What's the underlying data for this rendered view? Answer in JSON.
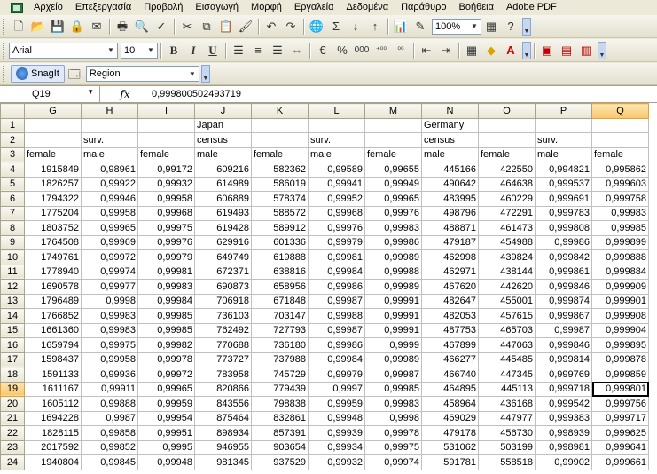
{
  "menubar": {
    "items": [
      "Αρχείο",
      "Επεξεργασία",
      "Προβολή",
      "Εισαγωγή",
      "Μορφή",
      "Εργαλεία",
      "Δεδομένα",
      "Παράθυρο",
      "Βοήθεια",
      "Adobe PDF"
    ]
  },
  "toolbar_standard": {
    "zoom": "100%",
    "icons": [
      "new-icon",
      "open-icon",
      "save-icon",
      "permission-icon",
      "email-icon",
      "print-icon",
      "print-preview-icon",
      "spelling-icon",
      "cut-icon",
      "copy-icon",
      "paste-icon",
      "format-painter-icon",
      "undo-icon",
      "redo-icon",
      "hyperlink-icon",
      "autosum-icon",
      "sort-ascending-icon",
      "sort-descending-icon",
      "chart-wizard-icon",
      "drawing-icon",
      "calculator-icon",
      "help-icon"
    ]
  },
  "toolbar_formatting": {
    "font": "Arial",
    "size": "10",
    "bold": "B",
    "italic": "I",
    "underline": "U",
    "currency": "€",
    "percent": "%",
    "thousands": "000",
    "inc_decimal": "⁺⁰⁰",
    "dec_decimal": "⁰⁰"
  },
  "toolbar_snagit": {
    "snagit_label": "SnagIt",
    "capture_mode": "Region"
  },
  "formulabar": {
    "cell_ref": "Q19",
    "fx": "fx",
    "content": "0,999800502493719"
  },
  "sheet": {
    "columns": [
      "G",
      "H",
      "I",
      "J",
      "K",
      "L",
      "M",
      "N",
      "O",
      "P",
      "Q"
    ],
    "selected_column": "Q",
    "selected_row": "19",
    "rows": [
      {
        "n": "1",
        "cells": [
          "",
          "",
          "",
          "Japan",
          "",
          "",
          "",
          "Germany",
          "",
          "",
          ""
        ]
      },
      {
        "n": "2",
        "cells": [
          "",
          "surv.",
          "",
          "census",
          "",
          "surv.",
          "",
          "census",
          "",
          "surv.",
          ""
        ]
      },
      {
        "n": "3",
        "cells": [
          "female",
          "male",
          "female",
          "male",
          "female",
          "male",
          "female",
          "male",
          "female",
          "male",
          "female"
        ]
      },
      {
        "n": "4",
        "cells": [
          "1915849",
          "0,98961",
          "0,99172",
          "609216",
          "582362",
          "0,99589",
          "0,99655",
          "445166",
          "422550",
          "0,994821",
          "0,995862"
        ]
      },
      {
        "n": "5",
        "cells": [
          "1826257",
          "0,99922",
          "0,99932",
          "614989",
          "586019",
          "0,99941",
          "0,99949",
          "490642",
          "464638",
          "0,999537",
          "0,999603"
        ]
      },
      {
        "n": "6",
        "cells": [
          "1794322",
          "0,99946",
          "0,99958",
          "606889",
          "578374",
          "0,99952",
          "0,99965",
          "483995",
          "460229",
          "0,999691",
          "0,999758"
        ]
      },
      {
        "n": "7",
        "cells": [
          "1775204",
          "0,99958",
          "0,99968",
          "619493",
          "588572",
          "0,99968",
          "0,99976",
          "498796",
          "472291",
          "0,999783",
          "0,99983"
        ]
      },
      {
        "n": "8",
        "cells": [
          "1803752",
          "0,99965",
          "0,99975",
          "619428",
          "589912",
          "0,99976",
          "0,99983",
          "488871",
          "461473",
          "0,999808",
          "0,99985"
        ]
      },
      {
        "n": "9",
        "cells": [
          "1764508",
          "0,99969",
          "0,99976",
          "629916",
          "601336",
          "0,99979",
          "0,99986",
          "479187",
          "454988",
          "0,99986",
          "0,999899"
        ]
      },
      {
        "n": "10",
        "cells": [
          "1749761",
          "0,99972",
          "0,99979",
          "649749",
          "619888",
          "0,99981",
          "0,99989",
          "462998",
          "439824",
          "0,999842",
          "0,999888"
        ]
      },
      {
        "n": "11",
        "cells": [
          "1778940",
          "0,99974",
          "0,99981",
          "672371",
          "638816",
          "0,99984",
          "0,99988",
          "462971",
          "438144",
          "0,999861",
          "0,999884"
        ]
      },
      {
        "n": "12",
        "cells": [
          "1690578",
          "0,99977",
          "0,99983",
          "690873",
          "658956",
          "0,99986",
          "0,99989",
          "467620",
          "442620",
          "0,999846",
          "0,999909"
        ]
      },
      {
        "n": "13",
        "cells": [
          "1796489",
          "0,9998",
          "0,99984",
          "706918",
          "671848",
          "0,99987",
          "0,99991",
          "482647",
          "455001",
          "0,999874",
          "0,999901"
        ]
      },
      {
        "n": "14",
        "cells": [
          "1766852",
          "0,99983",
          "0,99985",
          "736103",
          "703147",
          "0,99988",
          "0,99991",
          "482053",
          "457615",
          "0,999867",
          "0,999908"
        ]
      },
      {
        "n": "15",
        "cells": [
          "1661360",
          "0,99983",
          "0,99985",
          "762492",
          "727793",
          "0,99987",
          "0,99991",
          "487753",
          "465703",
          "0,99987",
          "0,999904"
        ]
      },
      {
        "n": "16",
        "cells": [
          "1659794",
          "0,99975",
          "0,99982",
          "770688",
          "736180",
          "0,99986",
          "0,9999",
          "467899",
          "447063",
          "0,999846",
          "0,999895"
        ]
      },
      {
        "n": "17",
        "cells": [
          "1598437",
          "0,99958",
          "0,99978",
          "773727",
          "737988",
          "0,99984",
          "0,99989",
          "466277",
          "445485",
          "0,999814",
          "0,999878"
        ]
      },
      {
        "n": "18",
        "cells": [
          "1591133",
          "0,99936",
          "0,99972",
          "783958",
          "745729",
          "0,99979",
          "0,99987",
          "466740",
          "447345",
          "0,999769",
          "0,999859"
        ]
      },
      {
        "n": "19",
        "cells": [
          "1611167",
          "0,99911",
          "0,99965",
          "820866",
          "779439",
          "0,9997",
          "0,99985",
          "464895",
          "445113",
          "0,999718",
          "0,999801"
        ]
      },
      {
        "n": "20",
        "cells": [
          "1605112",
          "0,99888",
          "0,99959",
          "843556",
          "798838",
          "0,99959",
          "0,99983",
          "458964",
          "436168",
          "0,999542",
          "0,999756"
        ]
      },
      {
        "n": "21",
        "cells": [
          "1694228",
          "0,9987",
          "0,99954",
          "875464",
          "832861",
          "0,99948",
          "0,9998",
          "469029",
          "447977",
          "0,999383",
          "0,999717"
        ]
      },
      {
        "n": "22",
        "cells": [
          "1828115",
          "0,99858",
          "0,99951",
          "898934",
          "857391",
          "0,99939",
          "0,99978",
          "479178",
          "456730",
          "0,998939",
          "0,999625"
        ]
      },
      {
        "n": "23",
        "cells": [
          "2017592",
          "0,99852",
          "0,9995",
          "946955",
          "903654",
          "0,99934",
          "0,99975",
          "531062",
          "503199",
          "0,998981",
          "0,999641"
        ]
      },
      {
        "n": "24",
        "cells": [
          "1940804",
          "0,99845",
          "0,99948",
          "981345",
          "937529",
          "0,99932",
          "0,99974",
          "591781",
          "558518",
          "0,99902",
          "0,999661"
        ]
      }
    ]
  }
}
